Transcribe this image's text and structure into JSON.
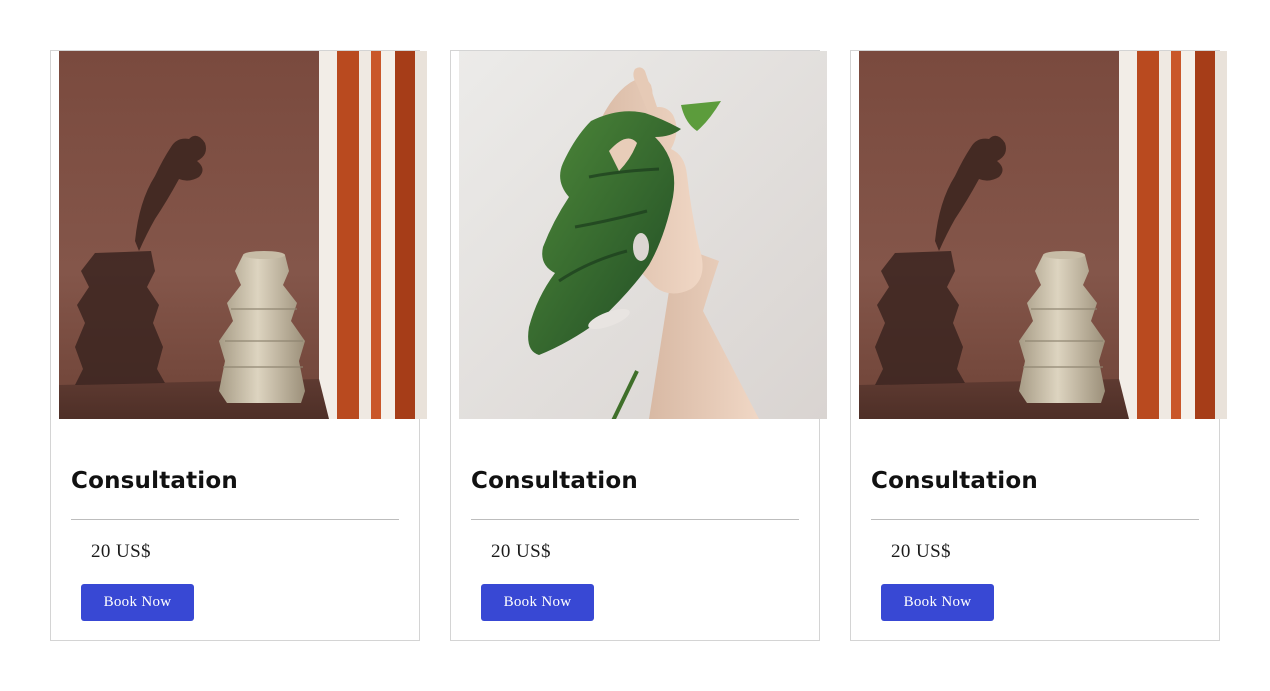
{
  "colors": {
    "button_bg": "#3848d4",
    "button_text": "#ffffff",
    "card_border": "#d4d4d4",
    "divider": "#bdbdbd"
  },
  "cards": [
    {
      "image": "terracotta-vase-photo",
      "title": "Consultation",
      "price": "20 US$",
      "button_label": "Book Now"
    },
    {
      "image": "hand-holding-monstera-leaf-photo",
      "title": "Consultation",
      "price": "20 US$",
      "button_label": "Book Now"
    },
    {
      "image": "terracotta-vase-photo",
      "title": "Consultation",
      "price": "20 US$",
      "button_label": "Book Now"
    }
  ]
}
